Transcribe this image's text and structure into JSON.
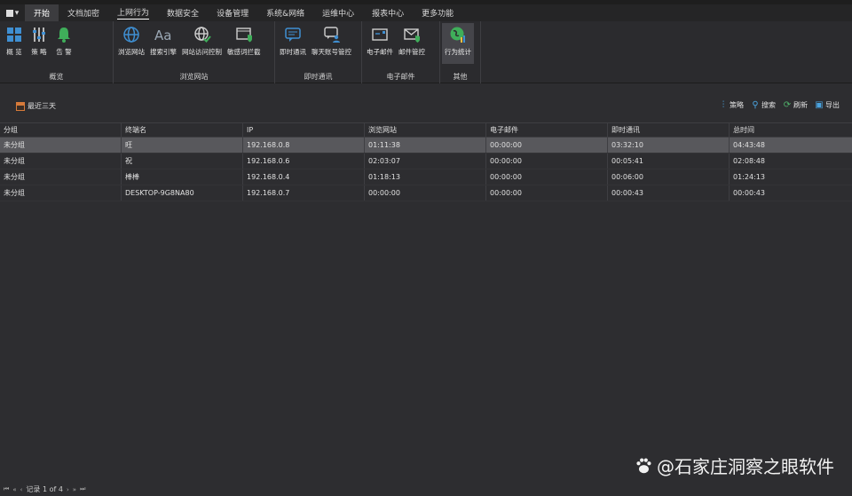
{
  "tabs": {
    "app_menu": "▾",
    "items": [
      {
        "label": "开始",
        "state": "active"
      },
      {
        "label": "文档加密",
        "state": ""
      },
      {
        "label": "上网行为",
        "state": "underlined"
      },
      {
        "label": "数据安全",
        "state": ""
      },
      {
        "label": "设备管理",
        "state": ""
      },
      {
        "label": "系统&网络",
        "state": ""
      },
      {
        "label": "运维中心",
        "state": ""
      },
      {
        "label": "报表中心",
        "state": ""
      },
      {
        "label": "更多功能",
        "state": ""
      }
    ]
  },
  "ribbon": {
    "groups": [
      {
        "label": "概览",
        "buttons": [
          {
            "label": "概 览",
            "icon": "grid-icon"
          },
          {
            "label": "策 略",
            "icon": "sliders-icon"
          },
          {
            "label": "告 警",
            "icon": "bell-icon"
          }
        ]
      },
      {
        "label": "浏览网站",
        "buttons": [
          {
            "label": "浏览网站",
            "icon": "globe-icon"
          },
          {
            "label": "搜索引擎",
            "icon": "font-icon"
          },
          {
            "label": "网站访问控制",
            "icon": "globe-check-icon"
          },
          {
            "label": "敏感词拦截",
            "icon": "browser-shield-icon"
          }
        ]
      },
      {
        "label": "即时通讯",
        "buttons": [
          {
            "label": "即时通讯",
            "icon": "chat-icon"
          },
          {
            "label": "聊天账号管控",
            "icon": "chat-user-icon"
          }
        ]
      },
      {
        "label": "电子邮件",
        "buttons": [
          {
            "label": "电子邮件",
            "icon": "mail-icon"
          },
          {
            "label": "邮件管控",
            "icon": "mail-shield-icon"
          }
        ]
      },
      {
        "label": "其他",
        "buttons": [
          {
            "label": "行为统计",
            "icon": "globe-chart-icon"
          }
        ]
      }
    ]
  },
  "toolbar": {
    "range_label": "最近三天",
    "strategy": "策略",
    "search": "搜索",
    "refresh": "刷新",
    "export": "导出"
  },
  "table": {
    "columns": [
      "分组",
      "终端名",
      "IP",
      "浏览网站",
      "电子邮件",
      "即时通讯",
      "总时间"
    ],
    "rows": [
      [
        "未分组",
        "旺",
        "192.168.0.8",
        "01:11:38",
        "00:00:00",
        "03:32:10",
        "04:43:48"
      ],
      [
        "未分组",
        "祝",
        "192.168.0.6",
        "02:03:07",
        "00:00:00",
        "00:05:41",
        "02:08:48"
      ],
      [
        "未分组",
        "棒棒",
        "192.168.0.4",
        "01:18:13",
        "00:00:00",
        "00:06:00",
        "01:24:13"
      ],
      [
        "未分组",
        "DESKTOP-9G8NA80",
        "192.168.0.7",
        "00:00:00",
        "00:00:00",
        "00:00:43",
        "00:00:43"
      ]
    ]
  },
  "navigator": {
    "record_text": "记录 1 of 4"
  },
  "watermark": {
    "text": "@石家庄洞察之眼软件"
  },
  "colors": {
    "accent_blue": "#3f8fd2",
    "accent_green": "#3fae5a",
    "selected_row": "#58585c"
  }
}
